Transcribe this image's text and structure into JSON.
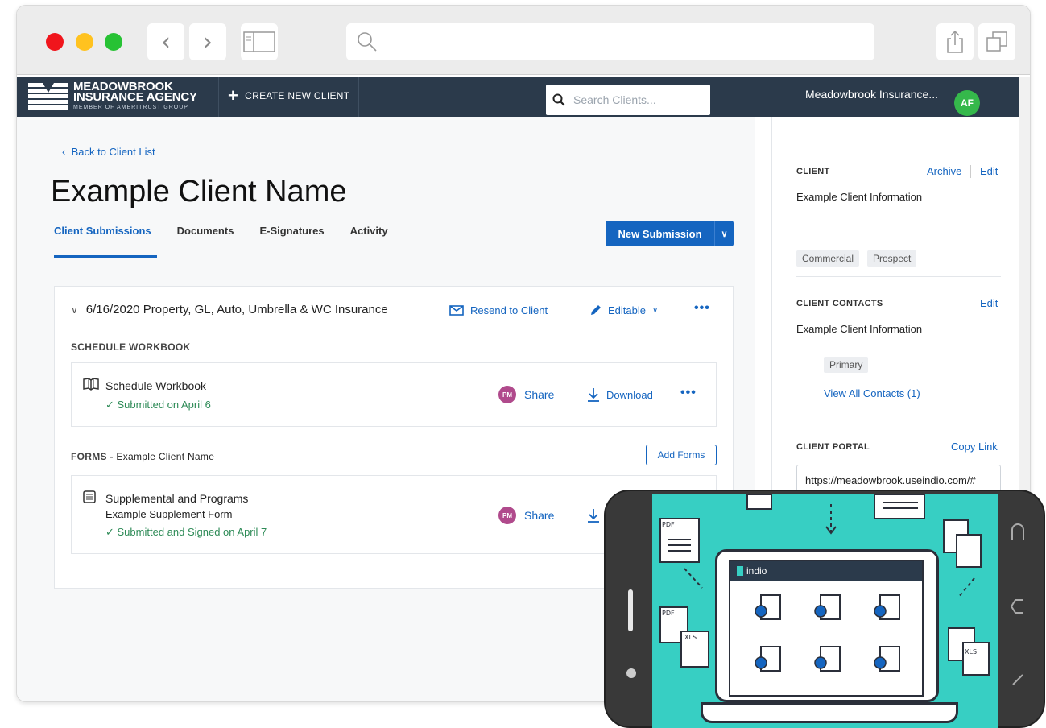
{
  "app": {
    "brand_line1": "MEADOWBROOK",
    "brand_line2": "INSURANCE AGENCY",
    "brand_line3": "MEMBER OF AMERITRUST GROUP",
    "create_label": "CREATE NEW CLIENT",
    "search_placeholder": "Search Clients...",
    "user_name": "Meadowbrook Insurance...",
    "user_initials": "AF"
  },
  "page": {
    "back_label": "Back to Client List",
    "title": "Example Client Name",
    "tabs": [
      "Client Submissions",
      "Documents",
      "E-Signatures",
      "Activity"
    ],
    "new_submission_label": "New Submission"
  },
  "submission": {
    "heading": "6/16/2020 Property, GL, Auto, Umbrella & WC Insurance",
    "resend_label": "Resend to Client",
    "editable_label": "Editable",
    "schedule_section": "SCHEDULE WORKBOOK",
    "workbook": {
      "name": "Schedule Workbook",
      "status": "Submitted on April 6",
      "share_label": "Share",
      "share_initials": "PM",
      "download_label": "Download"
    },
    "forms_section": "FORMS",
    "forms_client": "Example Client Name",
    "add_forms_label": "Add Forms",
    "form": {
      "name": "Supplemental and Programs",
      "subtitle": "Example Supplement Form",
      "status": "Submitted and Signed on April 7",
      "share_label": "Share",
      "share_initials": "PM"
    }
  },
  "sidebar": {
    "client_label": "CLIENT",
    "archive_label": "Archive",
    "edit_label": "Edit",
    "client_info": "Example Client Information",
    "tags": [
      "Commercial",
      "Prospect"
    ],
    "contacts_label": "CLIENT CONTACTS",
    "contacts_edit": "Edit",
    "contacts_info": "Example Client Information",
    "primary_tag": "Primary",
    "view_all": "View All Contacts (1)",
    "portal_label": "CLIENT PORTAL",
    "copy_link": "Copy Link",
    "portal_url": "https://meadowbrook.useindio.com/#"
  },
  "phone": {
    "app_name": "indio"
  },
  "colors": {
    "primary": "#1565c0",
    "appbar": "#2b3a4b",
    "success": "#2e8b57",
    "phone_screen": "#37cfc3"
  }
}
